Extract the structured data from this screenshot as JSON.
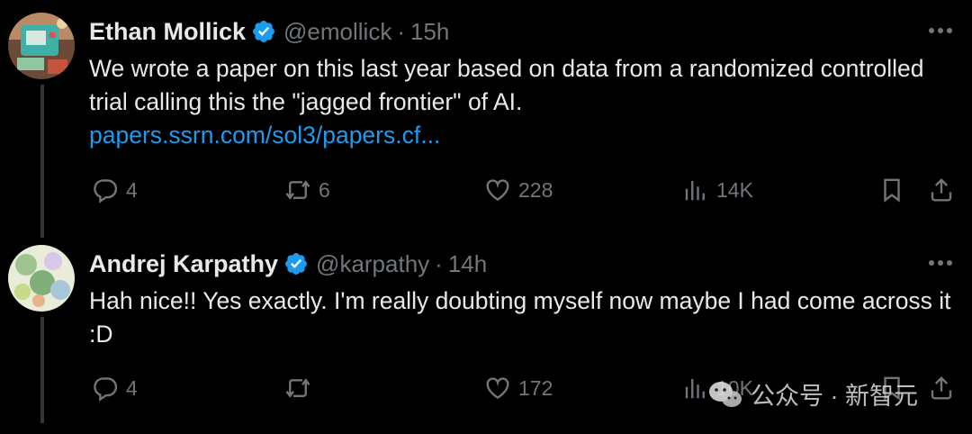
{
  "tweets": [
    {
      "author_name": "Ethan Mollick",
      "handle": "@emollick",
      "separator": "·",
      "time": "15h",
      "text": "We wrote a paper on this last year based on data from a randomized controlled trial calling this the \"jagged frontier\" of AI.",
      "link": "papers.ssrn.com/sol3/papers.cf...",
      "replies": "4",
      "reposts": "6",
      "likes": "228",
      "views": "14K",
      "verified": true
    },
    {
      "author_name": "Andrej Karpathy",
      "handle": "@karpathy",
      "separator": "·",
      "time": "14h",
      "text": "Hah nice!! Yes exactly. I'm really doubting myself now maybe I had come across it :D",
      "replies": "4",
      "reposts": "",
      "likes": "172",
      "views": "10K",
      "verified": true
    }
  ],
  "watermark": {
    "text": "公众号 · 新智元"
  },
  "colors": {
    "background": "#000000",
    "primary_text": "#e7e9ea",
    "secondary_text": "#71767b",
    "link": "#1d9bf0",
    "verified": "#1d9bf0"
  }
}
